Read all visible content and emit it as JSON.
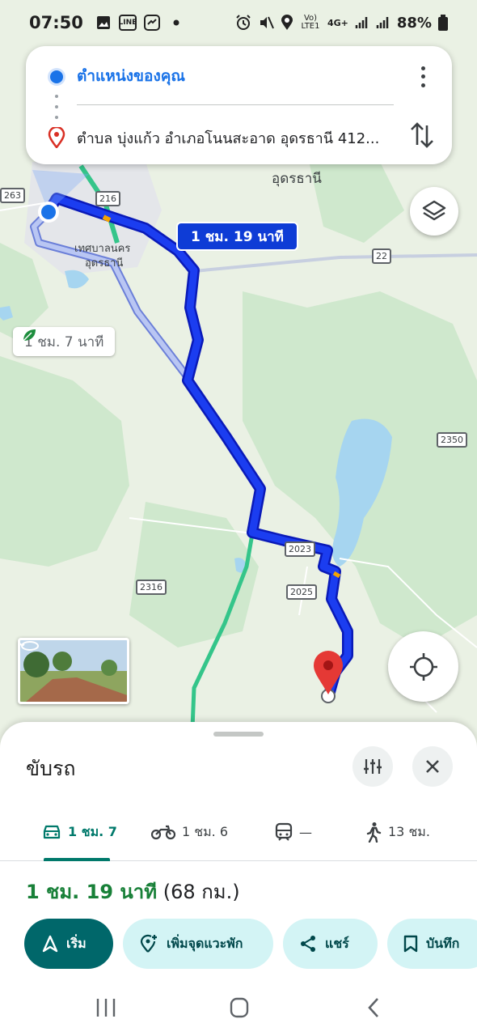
{
  "status_bar": {
    "time": "07:50",
    "network": "4G+",
    "volte": "Vo) LTE1",
    "battery": "88%"
  },
  "route_card": {
    "origin": "ตำแหน่งของคุณ",
    "destination": "ตำบล บุ่งแก้ว อำเภอโนนสะอาด อุดรธานี 412...",
    "origin_icon": "blue-dot-icon",
    "destination_icon": "red-pin-icon"
  },
  "map": {
    "city_label": "อุดรธานี",
    "municipality_label_line1": "เทศบาลนคร",
    "municipality_label_line2": "อุดรธานี",
    "selected_route_label": "1 ชม. 19 นาที",
    "alt_route_label": "1 ชม. 7 นาที",
    "road_shields": [
      "263",
      "216",
      "22",
      "2350",
      "2023",
      "2316",
      "2025"
    ],
    "colors": {
      "selected_route": "#1a2ee6",
      "alt_route": "#a9b8f0",
      "highway": "#34c58a",
      "water": "#a4d4ef",
      "forest": "#cde8cc"
    }
  },
  "sheet": {
    "title": "ขับรถ",
    "tabs": [
      {
        "label": "1 ชม. 7",
        "icon": "car-icon",
        "selected": true
      },
      {
        "label": "1 ชม. 6",
        "icon": "motorbike-icon",
        "selected": false
      },
      {
        "label": "—",
        "icon": "train-icon",
        "selected": false
      },
      {
        "label": "13 ชม.",
        "icon": "walk-icon",
        "selected": false
      }
    ],
    "duration": "1 ชม. 19 นาที",
    "distance": "(68 กม.)",
    "actions": {
      "start": "เริ่ม",
      "add_stop": "เพิ่มจุดแวะพัก",
      "share": "แชร์",
      "save": "บันทึก"
    }
  }
}
